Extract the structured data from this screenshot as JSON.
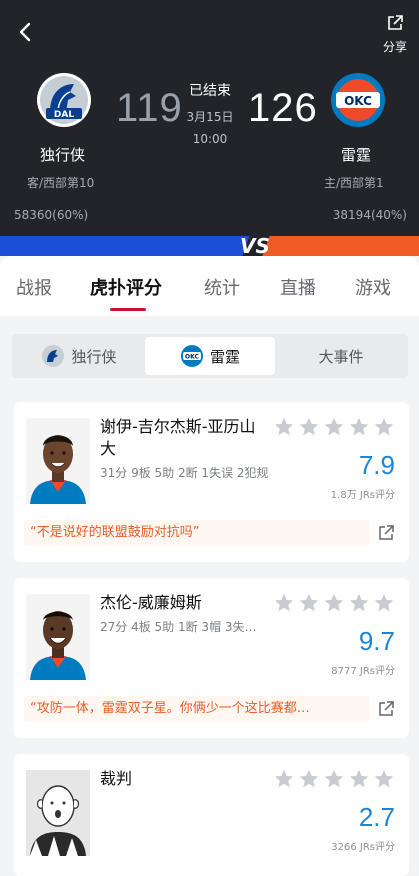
{
  "header": {
    "share_label": "分享",
    "status": "已结束",
    "date": "3月15日",
    "time": "10:00"
  },
  "away": {
    "abbr": "DAL",
    "name": "独行侠",
    "score": "119",
    "rank": "客/西部第10",
    "support": "58360(60%)",
    "color": "#0a3f8f"
  },
  "home": {
    "abbr": "OKC",
    "name": "雷霆",
    "score": "126",
    "rank": "主/西部第1",
    "support": "38194(40%)",
    "color": "#ef4b2b"
  },
  "vs_label": "VS",
  "tabs": [
    "战报",
    "虎扑评分",
    "统计",
    "直播",
    "游戏"
  ],
  "active_tab": "虎扑评分",
  "team_switch": {
    "away_label": "独行侠",
    "home_label": "雷霆",
    "events_label": "大事件",
    "active": "雷霆"
  },
  "players": [
    {
      "name": "谢伊-吉尔杰斯-亚历山大",
      "stats": "31分 9板 5助 2断 1失误 2犯规",
      "rating": "7.9",
      "rating_count": "1.8万 JRs评分",
      "comment": "“不是说好的联盟鼓励对抗吗”"
    },
    {
      "name": "杰伦-威廉姆斯",
      "stats": "27分 4板 5助 1断 3帽 3失…",
      "rating": "9.7",
      "rating_count": "8777 JRs评分",
      "comment": "“攻防一体，雷霆双子星。你俩少一个这比赛都…"
    },
    {
      "name": "裁判",
      "rating": "2.7",
      "rating_count": "3266 JRs评分"
    }
  ],
  "colors": {
    "accent_red": "#c8102e",
    "rating_blue": "#1a86d8",
    "comment_orange": "#e85d2a",
    "vs_blue": "#1c4fd6",
    "vs_orange": "#f05a24"
  },
  "icons": [
    "back-icon",
    "share-icon",
    "star-icon",
    "external-share-icon"
  ]
}
